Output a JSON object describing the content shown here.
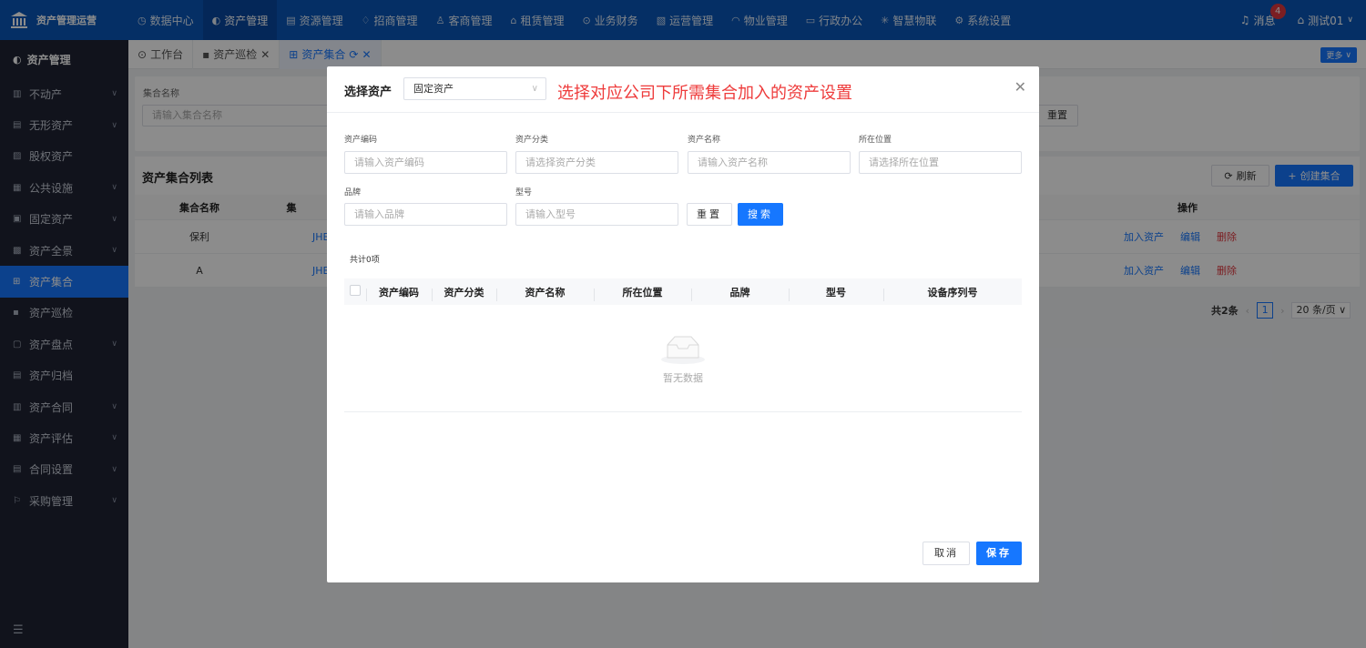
{
  "app": {
    "title": "资产管理运营"
  },
  "nav": [
    {
      "icon": "◷",
      "label": "数据中心",
      "active": false
    },
    {
      "icon": "◐",
      "label": "资产管理",
      "active": true
    },
    {
      "icon": "▤",
      "label": "资源管理",
      "active": false
    },
    {
      "icon": "♢",
      "label": "招商管理",
      "active": false
    },
    {
      "icon": "♙",
      "label": "客商管理",
      "active": false
    },
    {
      "icon": "⌂",
      "label": "租赁管理",
      "active": false
    },
    {
      "icon": "⊙",
      "label": "业务财务",
      "active": false
    },
    {
      "icon": "▧",
      "label": "运营管理",
      "active": false
    },
    {
      "icon": "◠",
      "label": "物业管理",
      "active": false
    },
    {
      "icon": "▭",
      "label": "行政办公",
      "active": false
    },
    {
      "icon": "✳",
      "label": "智慧物联",
      "active": false
    },
    {
      "icon": "⚙",
      "label": "系统设置",
      "active": false
    }
  ],
  "header": {
    "messages_label": "消息",
    "messages_count": "4",
    "user_name": "测试01"
  },
  "sidebar": {
    "title": "资产管理",
    "items": [
      {
        "label": "不动产",
        "expandable": true,
        "active": false
      },
      {
        "label": "无形资产",
        "expandable": true,
        "active": false
      },
      {
        "label": "股权资产",
        "expandable": false,
        "active": false
      },
      {
        "label": "公共设施",
        "expandable": true,
        "active": false
      },
      {
        "label": "固定资产",
        "expandable": true,
        "active": false
      },
      {
        "label": "资产全景",
        "expandable": true,
        "active": false
      },
      {
        "label": "资产集合",
        "expandable": false,
        "active": true
      },
      {
        "label": "资产巡检",
        "expandable": false,
        "active": false
      },
      {
        "label": "资产盘点",
        "expandable": true,
        "active": false
      },
      {
        "label": "资产归档",
        "expandable": false,
        "active": false
      },
      {
        "label": "资产合同",
        "expandable": true,
        "active": false
      },
      {
        "label": "资产评估",
        "expandable": true,
        "active": false
      },
      {
        "label": "合同设置",
        "expandable": true,
        "active": false
      },
      {
        "label": "采购管理",
        "expandable": true,
        "active": false
      }
    ]
  },
  "tabs": [
    {
      "label": "工作台",
      "active": false,
      "closable": false
    },
    {
      "label": "资产巡检",
      "active": false,
      "closable": true
    },
    {
      "label": "资产集合",
      "active": true,
      "closable": true
    }
  ],
  "tabbar": {
    "more_label": "更多"
  },
  "filter": {
    "label": "集合名称",
    "placeholder": "请输入集合名称",
    "reset_label": "重置"
  },
  "list": {
    "title": "资产集合列表",
    "refresh_label": "刷新",
    "create_label": "创建集合",
    "columns": [
      "集合名称",
      "集"
    ],
    "op_header": "操作",
    "rows": [
      {
        "name": "保利",
        "code": "JHB"
      },
      {
        "name": "A",
        "code": "JHB"
      }
    ],
    "actions": {
      "add": "加入资产",
      "edit": "编辑",
      "delete": "删除"
    },
    "pager": {
      "total": "共2条",
      "page": "1",
      "size": "20 条/页"
    }
  },
  "modal": {
    "title": "选择资产",
    "type_value": "固定资产",
    "note": "选择对应公司下所需集合加入的资产设置",
    "fields": {
      "code": {
        "label": "资产编码",
        "placeholder": "请输入资产编码"
      },
      "category": {
        "label": "资产分类",
        "placeholder": "请选择资产分类"
      },
      "name": {
        "label": "资产名称",
        "placeholder": "请输入资产名称"
      },
      "location": {
        "label": "所在位置",
        "placeholder": "请选择所在位置"
      },
      "brand": {
        "label": "品牌",
        "placeholder": "请输入品牌"
      },
      "model": {
        "label": "型号",
        "placeholder": "请输入型号"
      }
    },
    "reset_label": "重置",
    "search_label": "搜索",
    "total": "共计0项",
    "columns": [
      "资产编码",
      "资产分类",
      "资产名称",
      "所在位置",
      "品牌",
      "型号",
      "设备序列号"
    ],
    "empty_text": "暂无数据",
    "cancel_label": "取消",
    "save_label": "保存"
  }
}
